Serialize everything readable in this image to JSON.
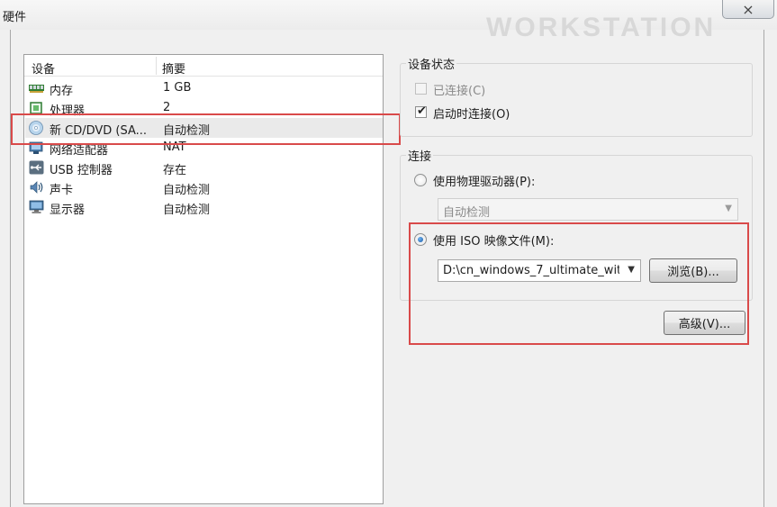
{
  "window": {
    "title": "硬件",
    "watermark": "WORKSTATION",
    "close_glyph": "⨯"
  },
  "device_list": {
    "columns": [
      "设备",
      "摘要"
    ],
    "rows": [
      {
        "icon": "memory-icon",
        "name": "内存",
        "summary": "1 GB",
        "selected": false
      },
      {
        "icon": "processor-icon",
        "name": "处理器",
        "summary": "2",
        "selected": false
      },
      {
        "icon": "cd-dvd-icon",
        "name": "新 CD/DVD (SA...",
        "summary": "自动检测",
        "selected": true
      },
      {
        "icon": "network-adapter-icon",
        "name": "网络适配器",
        "summary": "NAT",
        "selected": false
      },
      {
        "icon": "usb-icon",
        "name": "USB 控制器",
        "summary": "存在",
        "selected": false
      },
      {
        "icon": "sound-card-icon",
        "name": "声卡",
        "summary": "自动检测",
        "selected": false
      },
      {
        "icon": "display-icon",
        "name": "显示器",
        "summary": "自动检测",
        "selected": false
      }
    ]
  },
  "device_status": {
    "title": "设备状态",
    "connected": {
      "label": "已连接(C)",
      "checked": false,
      "disabled": true
    },
    "connect_at_power_on": {
      "label": "启动时连接(O)",
      "checked": true,
      "disabled": false
    }
  },
  "connection": {
    "title": "连接",
    "physical_drive": {
      "label": "使用物理驱动器(P):",
      "selected": false,
      "value": "自动检测"
    },
    "iso_image": {
      "label": "使用 ISO 映像文件(M):",
      "selected": true,
      "value": "D:\\cn_windows_7_ultimate_wit"
    },
    "browse_label": "浏览(B)...",
    "advanced_label": "高级(V)..."
  },
  "colors": {
    "highlight": "#d94a4a",
    "selected_row": "#eaeaea",
    "background": "#f0f0f0"
  }
}
